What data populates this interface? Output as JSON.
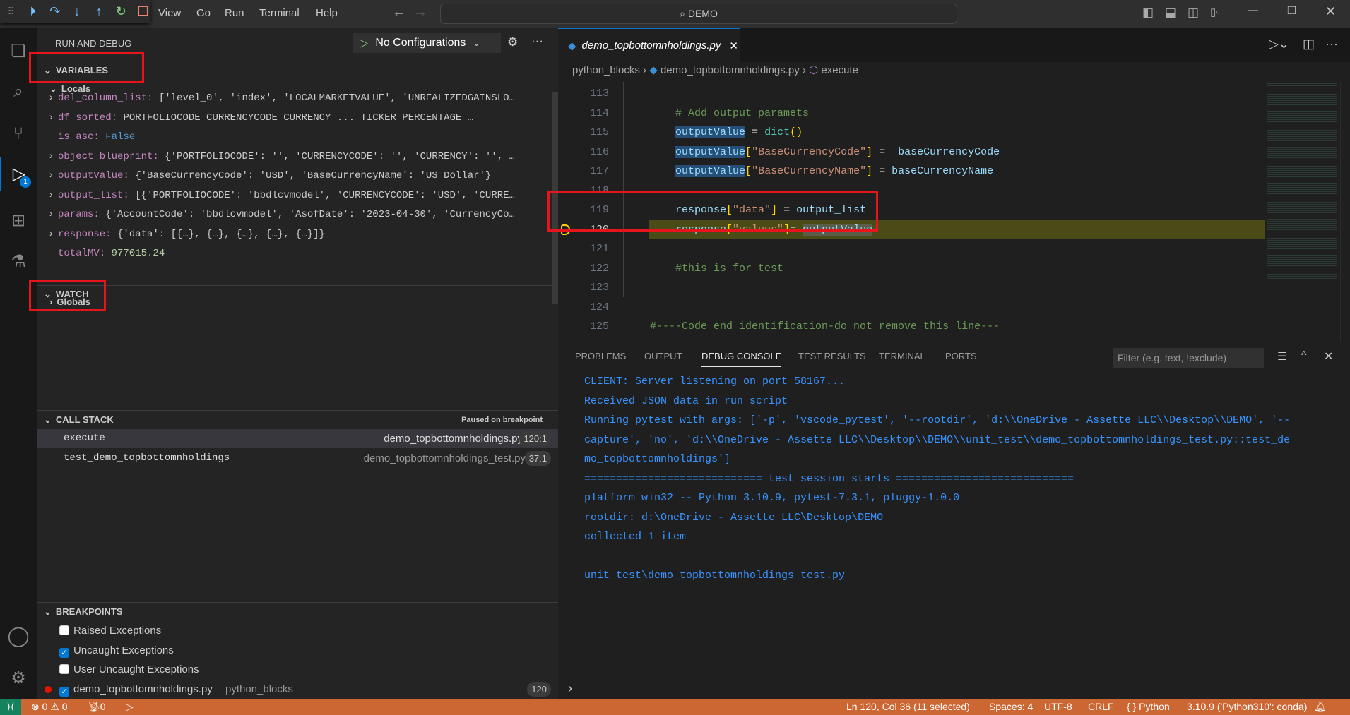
{
  "titlebar": {
    "menus": [
      "View",
      "Go",
      "Run",
      "Terminal",
      "Help"
    ],
    "search": "DEMO"
  },
  "debug_toolbar": [
    "continue",
    "step-over",
    "step-into",
    "step-out",
    "restart",
    "stop"
  ],
  "sidebar": {
    "title": "RUN AND DEBUG",
    "config": "No Configurations",
    "variables_header": "VARIABLES",
    "locals": "Locals",
    "vars": [
      {
        "name": "del_column_list",
        "value": "['level_0', 'index', 'LOCALMARKETVALUE', 'UNREALIZEDGAINSLO…"
      },
      {
        "name": "df_sorted",
        "value": "  PORTFOLIOCODE CURRENCYCODE   CURRENCY  ... TICKER PERCENTAGE   …"
      },
      {
        "name": "is_asc",
        "value": "False"
      },
      {
        "name": "object_blueprint",
        "value": "{'PORTFOLIOCODE': '', 'CURRENCYCODE': '', 'CURRENCY': '', …"
      },
      {
        "name": "outputValue",
        "value": "{'BaseCurrencyCode': 'USD', 'BaseCurrencyName': 'US Dollar'}"
      },
      {
        "name": "output_list",
        "value": "[{'PORTFOLIOCODE': 'bbdlcvmodel', 'CURRENCYCODE': 'USD', 'CURRE…"
      },
      {
        "name": "params",
        "value": "{'AccountCode': 'bbdlcvmodel', 'AsofDate': '2023-04-30', 'CurrencyCo…"
      },
      {
        "name": "response",
        "value": "{'data': [{…}, {…}, {…}, {…}, {…}]}"
      },
      {
        "name": "totalMV",
        "value": "977015.24"
      }
    ],
    "globals": "Globals",
    "watch_header": "WATCH",
    "callstack_header": "CALL STACK",
    "callstack_status": "Paused on breakpoint",
    "frames": [
      {
        "name": "execute",
        "file": "demo_topbottomnholdings.py",
        "pos": "120:1"
      },
      {
        "name": "test_demo_topbottomnholdings",
        "file": "demo_topbottomnholdings_test.py",
        "pos": "37:1"
      }
    ],
    "breakpoints_header": "BREAKPOINTS",
    "breakpoints": [
      {
        "label": "Raised Exceptions",
        "checked": false
      },
      {
        "label": "Uncaught Exceptions",
        "checked": true
      },
      {
        "label": "User Uncaught Exceptions",
        "checked": false
      }
    ],
    "bp_file": {
      "name": "demo_topbottomnholdings.py",
      "folder": "python_blocks",
      "line": "120"
    },
    "debug_badge": "1"
  },
  "editor": {
    "tab": "demo_topbottomnholdings.py",
    "breadcrumb": [
      "python_blocks",
      "demo_topbottomnholdings.py",
      "execute"
    ],
    "lines": [
      "113",
      "114",
      "115",
      "116",
      "117",
      "118",
      "119",
      "120",
      "121",
      "122",
      "123",
      "124",
      "125"
    ]
  },
  "panel": {
    "tabs": [
      "PROBLEMS",
      "OUTPUT",
      "DEBUG CONSOLE",
      "TEST RESULTS",
      "TERMINAL",
      "PORTS"
    ],
    "filter_placeholder": "Filter (e.g. text, !exclude)",
    "console": [
      "CLIENT: Server listening on port 58167...",
      "Received JSON data in run script",
      "Running pytest with args: ['-p', 'vscode_pytest', '--rootdir', 'd:\\\\OneDrive - Assette LLC\\\\Desktop\\\\DEMO', '--",
      "capture', 'no', 'd:\\\\OneDrive - Assette LLC\\\\Desktop\\\\DEMO\\\\unit_test\\\\demo_topbottomnholdings_test.py::test_de",
      "mo_topbottomnholdings']",
      "============================ test session starts ============================",
      "platform win32 -- Python 3.10.9, pytest-7.3.1, pluggy-1.0.0",
      "rootdir: d:\\OneDrive - Assette LLC\\Desktop\\DEMO",
      "collected 1 item",
      "",
      "unit_test\\demo_topbottomnholdings_test.py"
    ]
  },
  "status": {
    "errors": "0",
    "warnings": "0",
    "ports": "0",
    "cursor": "Ln 120, Col 36 (11 selected)",
    "spaces": "Spaces: 4",
    "encoding": "UTF-8",
    "eol": "CRLF",
    "language": "Python",
    "interpreter": "3.10.9 ('Python310': conda)"
  },
  "colors": {
    "status_bar": "#cc6633",
    "highlight_box": "#e8141c",
    "console_text": "#3794ff"
  }
}
